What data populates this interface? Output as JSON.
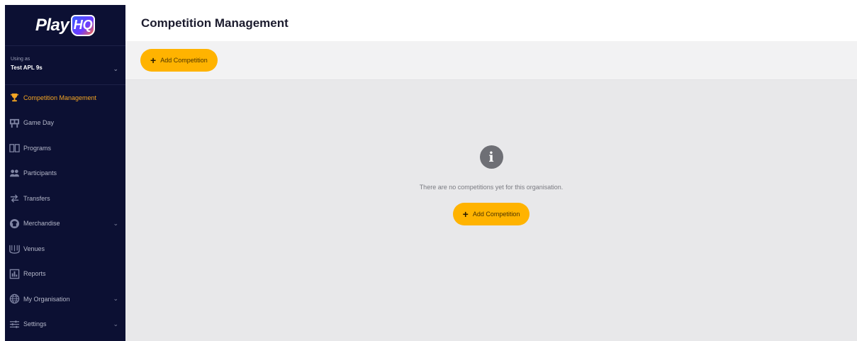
{
  "app": {
    "logo_text": "Play",
    "logo_badge": "HQ"
  },
  "org": {
    "label": "Using as",
    "name": "Test APL 9s"
  },
  "sidebar": {
    "items": [
      {
        "label": "Competition Management",
        "icon": "trophy-icon",
        "active": true,
        "has_chevron": false
      },
      {
        "label": "Game Day",
        "icon": "scoreboard-icon",
        "active": false,
        "has_chevron": false
      },
      {
        "label": "Programs",
        "icon": "book-icon",
        "active": false,
        "has_chevron": false
      },
      {
        "label": "Participants",
        "icon": "people-icon",
        "active": false,
        "has_chevron": false
      },
      {
        "label": "Transfers",
        "icon": "transfer-arrows-icon",
        "active": false,
        "has_chevron": false
      },
      {
        "label": "Merchandise",
        "icon": "shirt-icon",
        "active": false,
        "has_chevron": true
      },
      {
        "label": "Venues",
        "icon": "stadium-icon",
        "active": false,
        "has_chevron": false
      },
      {
        "label": "Reports",
        "icon": "report-icon",
        "active": false,
        "has_chevron": false
      },
      {
        "label": "My Organisation",
        "icon": "globe-icon",
        "active": false,
        "has_chevron": true
      },
      {
        "label": "Settings",
        "icon": "sliders-icon",
        "active": false,
        "has_chevron": true
      }
    ]
  },
  "header": {
    "title": "Competition Management"
  },
  "toolbar": {
    "add_label": "Add Competition"
  },
  "empty_state": {
    "message": "There are no competitions yet for this organisation.",
    "add_label": "Add Competition"
  },
  "colors": {
    "sidebar_bg": "#0c1033",
    "accent": "#ffb300",
    "active_nav": "#f5a623",
    "content_bg": "#e8e8ea"
  }
}
